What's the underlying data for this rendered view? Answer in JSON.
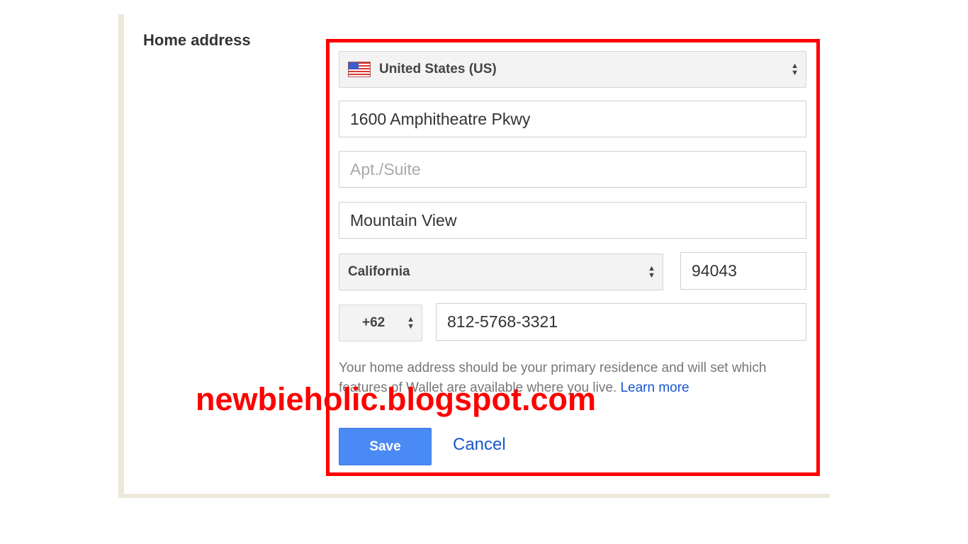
{
  "section_title": "Home address",
  "country": {
    "value": "United States (US)",
    "icon": "us-flag-icon"
  },
  "address_line1": {
    "value": "1600 Amphitheatre Pkwy"
  },
  "address_line2": {
    "value": "",
    "placeholder": "Apt./Suite"
  },
  "city": {
    "value": "Mountain View"
  },
  "state": {
    "value": "California"
  },
  "zip": {
    "value": "94043"
  },
  "phone_code": {
    "value": "+62"
  },
  "phone": {
    "value": "812-5768-3321"
  },
  "help_text": "Your home address should be your primary residence and will set which features of Wallet are available where you live.",
  "learn_more": "Learn more",
  "save_label": "Save",
  "cancel_label": "Cancel",
  "watermark": "newbieholic.blogspot.com",
  "colors": {
    "highlight": "#ff0000",
    "primary": "#4a8af4",
    "link": "#1a56cc"
  }
}
